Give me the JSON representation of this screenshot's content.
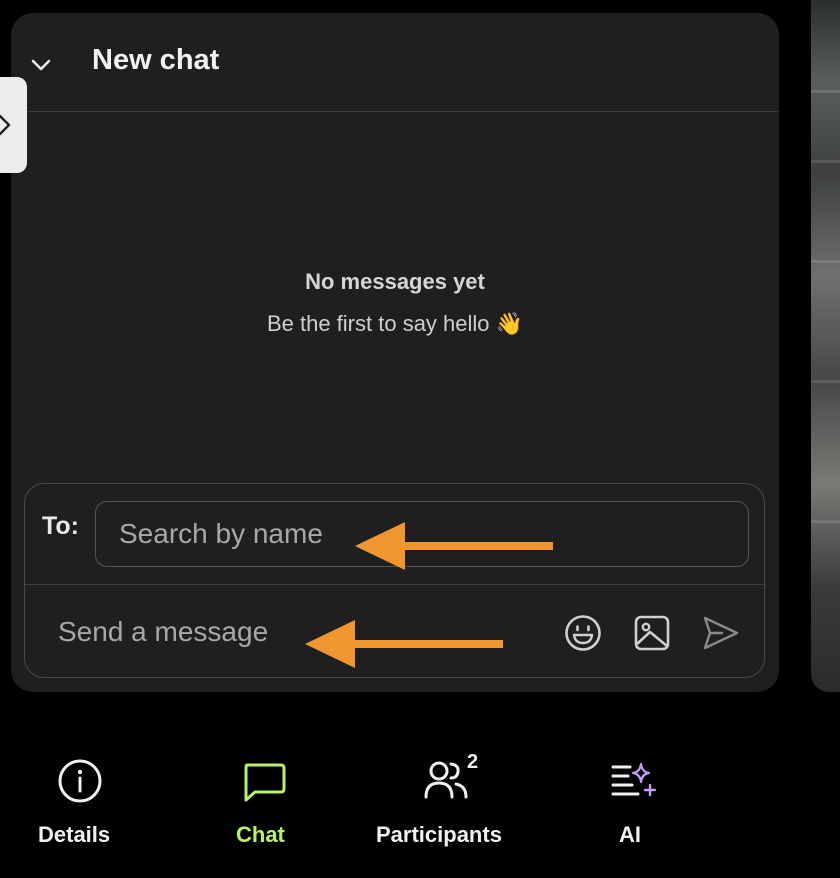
{
  "chat": {
    "title": "New chat",
    "empty_title": "No messages yet",
    "empty_subtitle": "Be the first to say hello 👋"
  },
  "composer": {
    "to_label": "To:",
    "to_placeholder": "Search by name",
    "message_placeholder": "Send a message"
  },
  "tabs": [
    {
      "label": "Details",
      "icon": "info-icon",
      "active": false
    },
    {
      "label": "Chat",
      "icon": "chat-bubble-icon",
      "active": true
    },
    {
      "label": "Participants",
      "icon": "participants-icon",
      "active": false,
      "badge": "2"
    },
    {
      "label": "AI",
      "icon": "ai-sparkle-icon",
      "active": false
    }
  ],
  "colors": {
    "panel_bg": "#1f1f1f",
    "accent": "#b6f36b",
    "annotation_arrow": "#f0962e",
    "ai_sparkle": "#c79cf5"
  }
}
